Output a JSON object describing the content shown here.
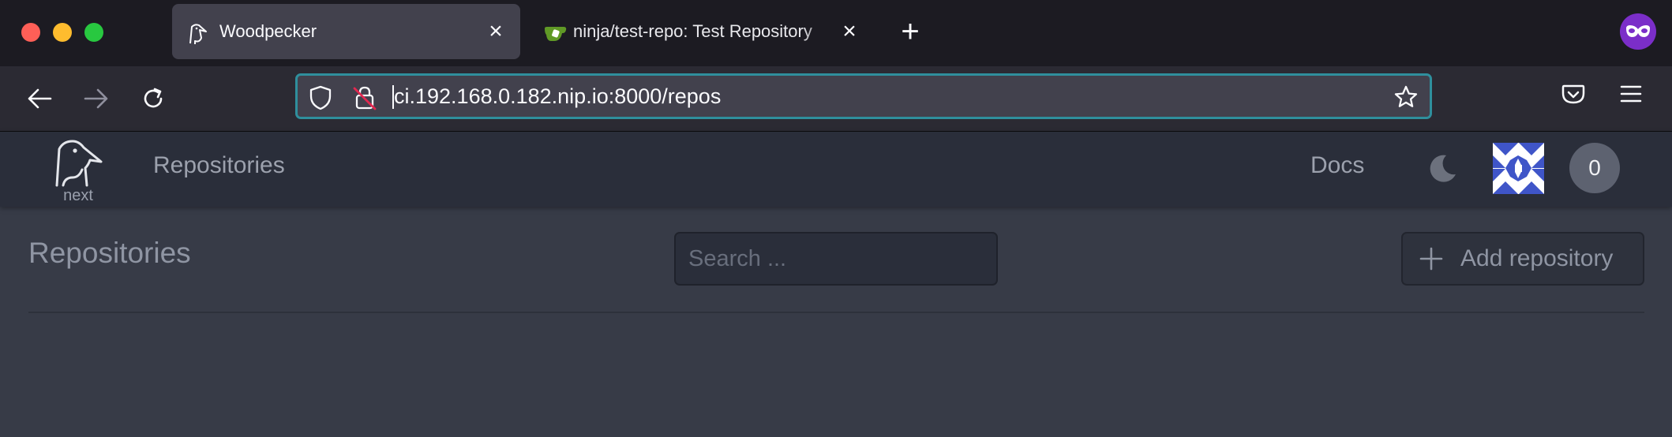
{
  "browser": {
    "tabs": [
      {
        "title": "Woodpecker",
        "favicon": "woodpecker-logo-icon",
        "active": true
      },
      {
        "title": "ninja/test-repo: Test Repository",
        "favicon": "gitea-icon",
        "active": false
      }
    ],
    "url": "ci.192.168.0.182.nip.io:8000/repos",
    "accent_color": "#2f8f9d"
  },
  "app": {
    "nav": {
      "logo_subtitle": "next",
      "repositories_link": "Repositories",
      "docs_link": "Docs",
      "theme_icon": "moon-icon",
      "notification_count": "0"
    },
    "page": {
      "title": "Repositories",
      "search_placeholder": "Search ...",
      "add_repository_label": "Add repository"
    }
  }
}
